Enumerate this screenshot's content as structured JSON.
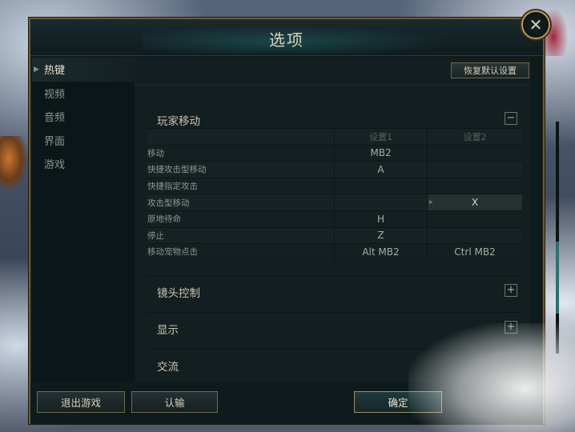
{
  "window": {
    "title": "选项",
    "close_glyph": "✕"
  },
  "sidebar": {
    "items": [
      {
        "label": "热键",
        "active": true
      },
      {
        "label": "视频",
        "active": false
      },
      {
        "label": "音频",
        "active": false
      },
      {
        "label": "界面",
        "active": false
      },
      {
        "label": "游戏",
        "active": false
      }
    ]
  },
  "toolbar": {
    "reset_label": "恢复默认设置"
  },
  "sections": [
    {
      "title": "玩家移动",
      "toggle": "−",
      "expanded": true
    },
    {
      "title": "镜头控制",
      "toggle": "+",
      "expanded": false
    },
    {
      "title": "显示",
      "toggle": "+",
      "expanded": false
    },
    {
      "title": "交流",
      "toggle": "",
      "expanded": false
    }
  ],
  "bind_table": {
    "headers": {
      "name": "",
      "set1": "设置1",
      "set2": "设置2"
    },
    "rows": [
      {
        "name": "移动",
        "set1": "MB2",
        "set2": ""
      },
      {
        "name": "快捷攻击型移动",
        "set1": "A",
        "set2": ""
      },
      {
        "name": "快捷指定攻击",
        "set1": "",
        "set2": ""
      },
      {
        "name": "攻击型移动",
        "set1": "",
        "set2": "X",
        "selected": true
      },
      {
        "name": "原地待命",
        "set1": "H",
        "set2": ""
      },
      {
        "name": "停止",
        "set1": "Z",
        "set2": ""
      },
      {
        "name": "移动宠物点击",
        "set1": "Alt MB2",
        "set2": "Ctrl MB2"
      }
    ]
  },
  "bottom": {
    "quit_label": "退出游戏",
    "surrender_label": "认输",
    "confirm_label": "确定"
  },
  "colors": {
    "frame_gold": "#6d5c35",
    "accent_teal": "#2f6f70",
    "panel_bg": "#131e20"
  }
}
